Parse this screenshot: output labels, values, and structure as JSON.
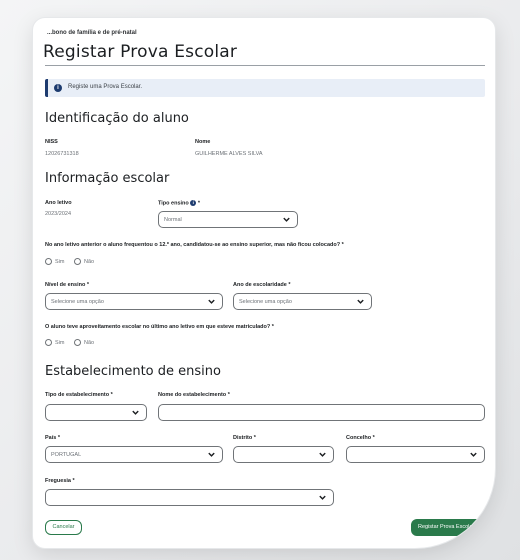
{
  "breadcrumb": "...bono de família e de pré-natal",
  "page_title": "Registar Prova Escolar",
  "alert": {
    "text": "Registe uma Prova Escolar."
  },
  "student": {
    "section_title": "Identificação do aluno",
    "niss_label": "NISS",
    "niss_value": "12026731318",
    "name_label": "Nome",
    "name_value": "GUILHERME ALVES SILVA"
  },
  "school_info": {
    "section_title": "Informação escolar",
    "school_year_label": "Ano letivo",
    "school_year_value": "2023/2024",
    "teaching_type_label": "Tipo ensino",
    "teaching_type_value": "Normal",
    "question1": "No ano letivo anterior o aluno frequentou o 12.º ano, candidatou-se ao ensino superior, mas não ficou colocado?",
    "q1_options": [
      "Sim",
      "Não"
    ],
    "level_label": "Nível de ensino",
    "level_placeholder": "Selecione uma opção",
    "grade_label": "Ano de escolaridade",
    "grade_placeholder": "Selecione uma opção",
    "question2": "O aluno teve aproveitamento escolar no último ano letivo em que esteve matriculado?",
    "q2_options": [
      "Sim",
      "Não"
    ]
  },
  "establishment": {
    "section_title": "Estabelecimento de ensino",
    "type_label": "Tipo de estabelecimento",
    "name_label": "Nome do estabelecimento",
    "country_label": "País",
    "country_value": "PORTUGAL",
    "district_label": "Distrito",
    "municipality_label": "Concelho",
    "parish_label": "Freguesia"
  },
  "actions": {
    "cancel": "Cancelar",
    "submit": "Registar Prova Escolar"
  },
  "required_marker": "*",
  "info_icon_glyph": "i",
  "colors": {
    "primary_green": "#2a7a4b",
    "info_blue": "#1d3b6f",
    "alert_bg": "#e8eef7"
  }
}
